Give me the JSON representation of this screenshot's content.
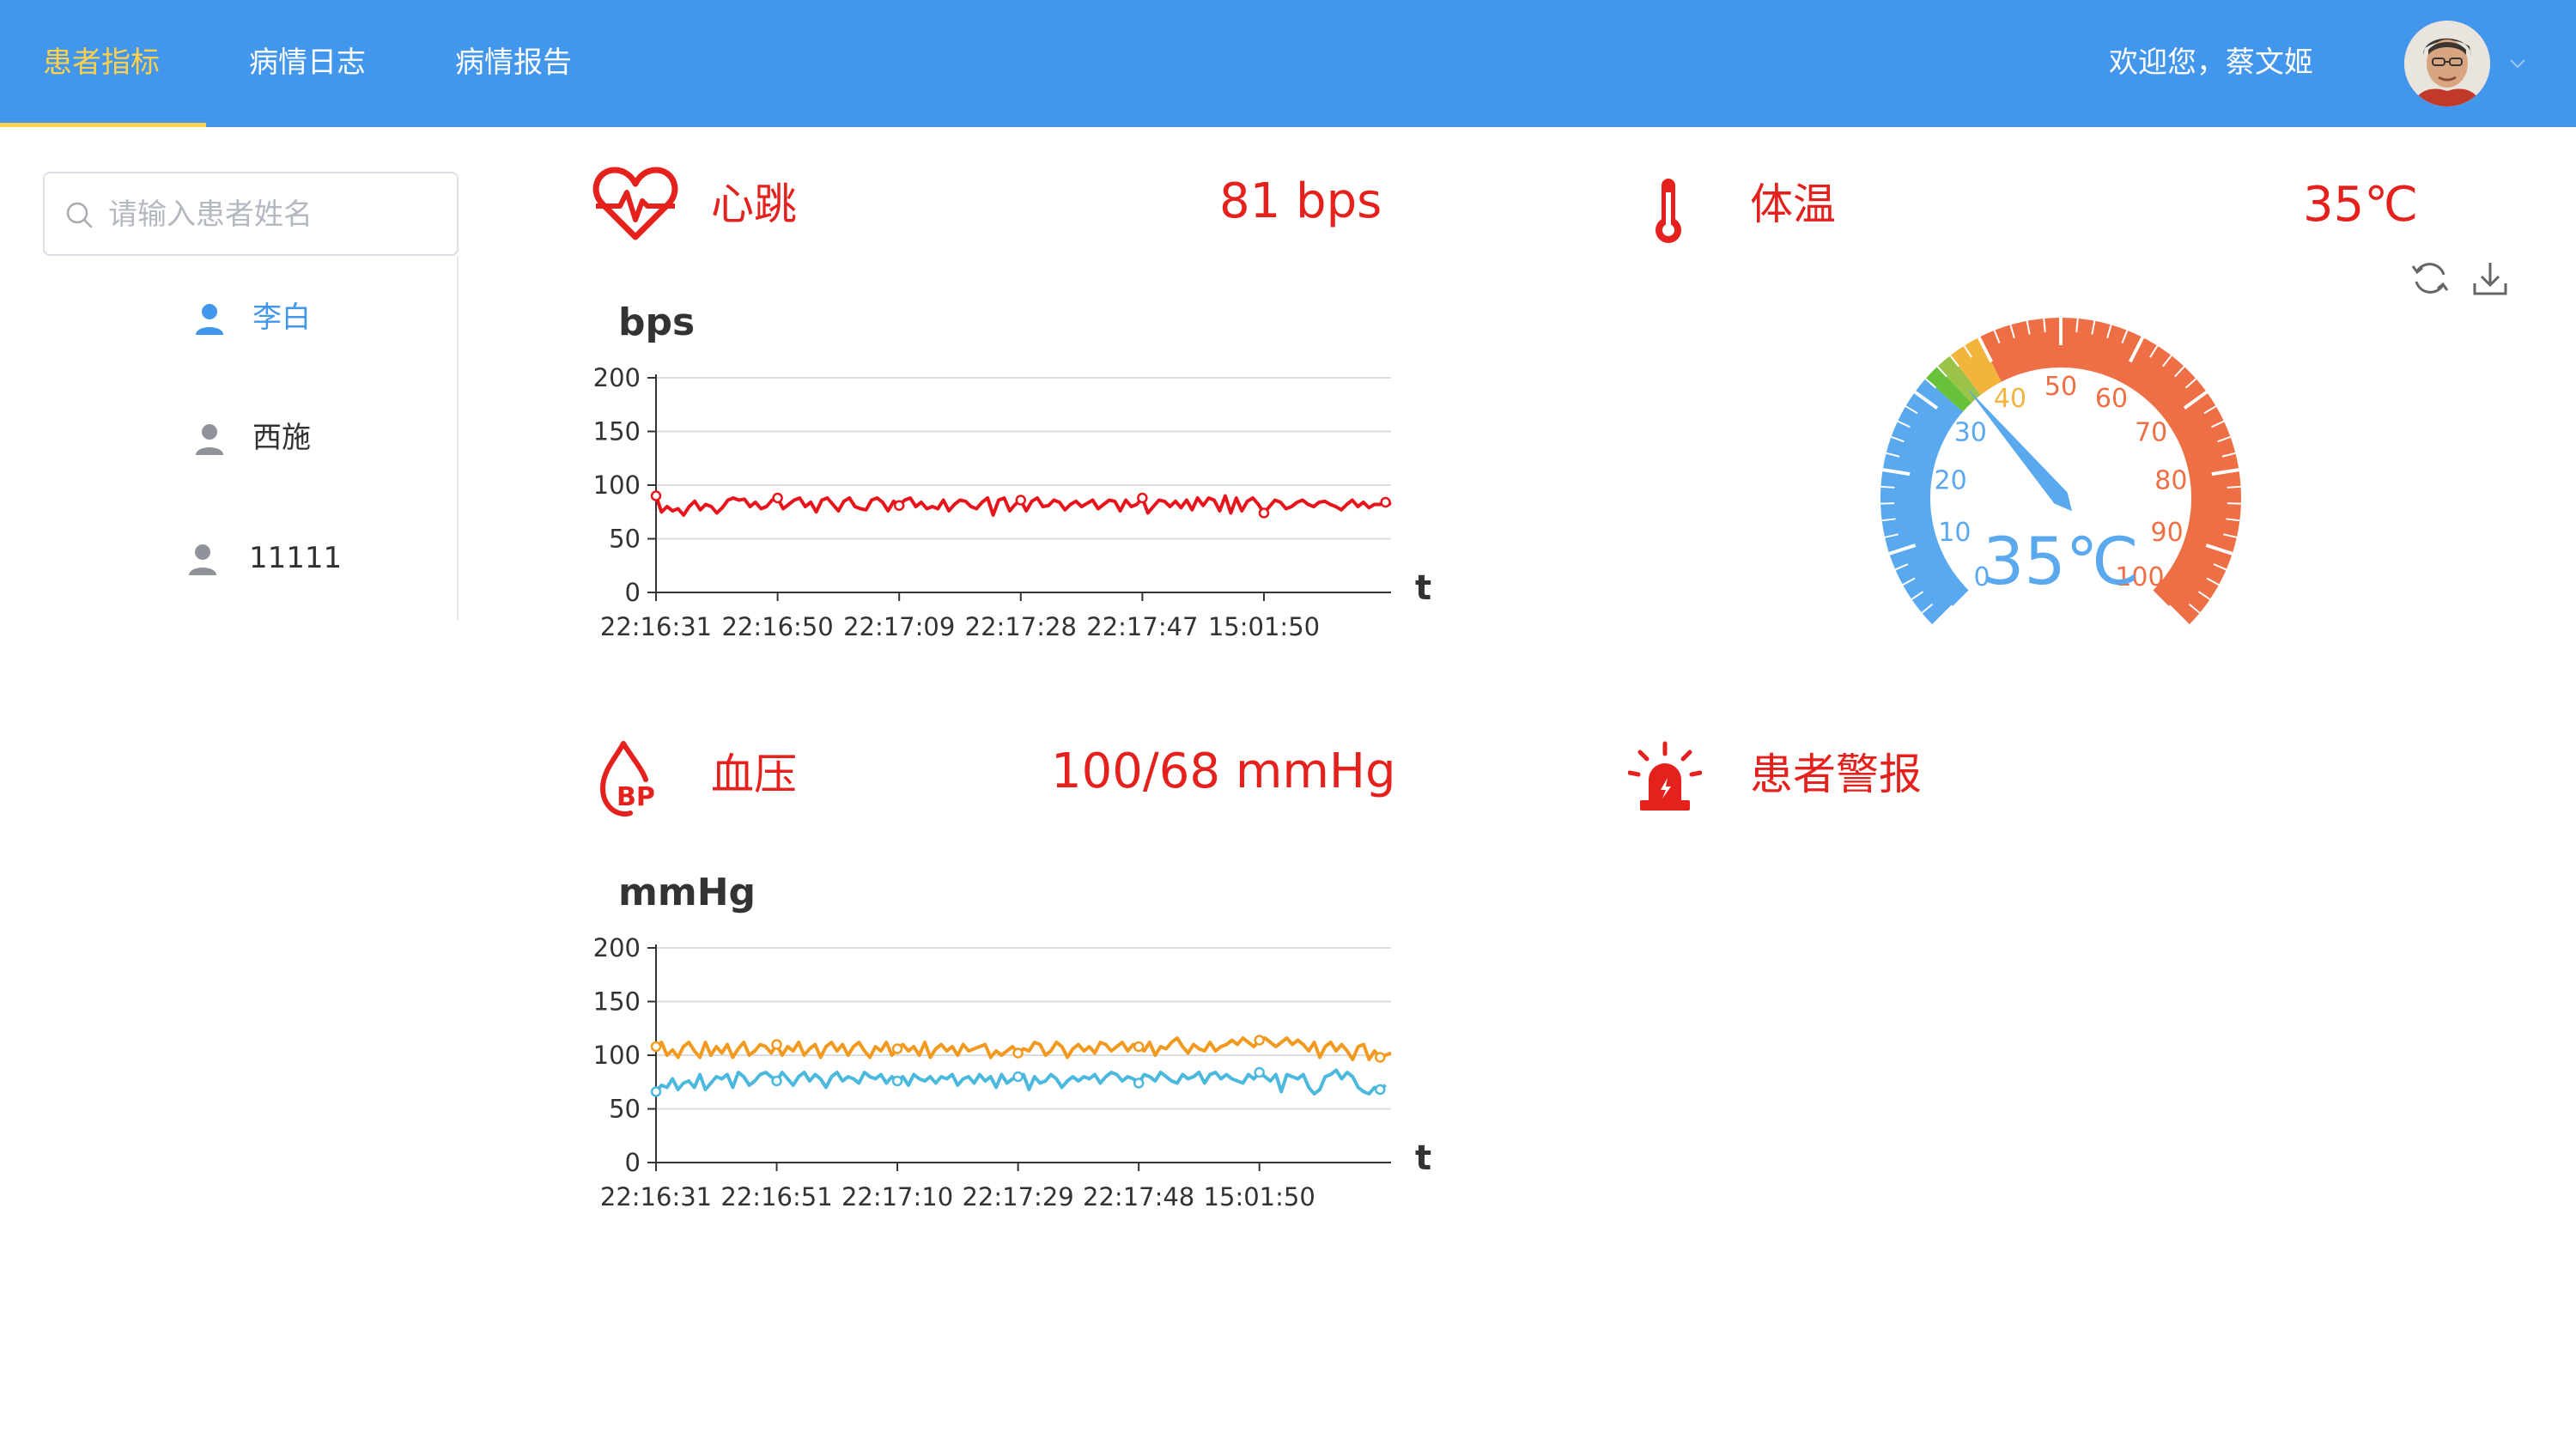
{
  "nav": {
    "tabs": [
      {
        "label": "患者指标",
        "active": true
      },
      {
        "label": "病情日志",
        "active": false
      },
      {
        "label": "病情报告",
        "active": false
      }
    ],
    "welcome": "欢迎您，蔡文姬"
  },
  "sidebar": {
    "search_placeholder": "请输入患者姓名",
    "patients": [
      {
        "name": "李白",
        "active": true
      },
      {
        "name": "西施",
        "active": false
      },
      {
        "name": "11111",
        "active": false
      }
    ]
  },
  "cards": {
    "heartbeat": {
      "title": "心跳",
      "value": "81 bps"
    },
    "temperature": {
      "title": "体温",
      "value": "35℃"
    },
    "blood_pressure": {
      "title": "血压",
      "value": "100/68 mmHg"
    },
    "alarm": {
      "title": "患者警报"
    }
  },
  "colors": {
    "topbar": "#4296eb",
    "active_tab": "#ffd04b",
    "alert_red": "#e5211d",
    "line_red": "#e8141c",
    "line_orange": "#f29a1f",
    "line_blue": "#4bb8de",
    "gauge_blue": "#5aa8ee",
    "gauge_orange": "#ee6f46"
  },
  "chart_data": [
    {
      "type": "line",
      "ylabel": "bps",
      "xlabel": "t",
      "ylim": [
        0,
        200
      ],
      "yticks": [
        0,
        50,
        100,
        150,
        200
      ],
      "xticks": [
        "22:16:31",
        "22:16:50",
        "22:17:09",
        "22:17:28",
        "22:17:47",
        "15:01:50"
      ],
      "grid": true,
      "series": [
        {
          "color": "#e8141c",
          "values": [
            90,
            75,
            80,
            76,
            78,
            72,
            80,
            85,
            77,
            82,
            80,
            74,
            79,
            86,
            88,
            86,
            87,
            80,
            84,
            78,
            80,
            86,
            88,
            78,
            82,
            86,
            88,
            80,
            84,
            75,
            86,
            88,
            82,
            76,
            85,
            88,
            80,
            78,
            77,
            86,
            88,
            84,
            76,
            85,
            81,
            86,
            88,
            80,
            84,
            78,
            80,
            78,
            86,
            76,
            82,
            86,
            85,
            80,
            78,
            84,
            88,
            72,
            86,
            88,
            76,
            82,
            86,
            76,
            85,
            88,
            80,
            81,
            86,
            84,
            77,
            82,
            85,
            80,
            83,
            86,
            78,
            82,
            86,
            85,
            76,
            86,
            80,
            82,
            88,
            74,
            80,
            86,
            85,
            80,
            85,
            79,
            86,
            77,
            88,
            81,
            88,
            86,
            76,
            90,
            74,
            88,
            76,
            85,
            88,
            82,
            74,
            80,
            86,
            84,
            78,
            80,
            84,
            86,
            82,
            80,
            84,
            85,
            82,
            80,
            77,
            82,
            86,
            80,
            84,
            79,
            82,
            82,
            84,
            82
          ]
        }
      ]
    },
    {
      "type": "line",
      "ylabel": "mmHg",
      "xlabel": "t",
      "ylim": [
        0,
        200
      ],
      "yticks": [
        0,
        50,
        100,
        150,
        200
      ],
      "xticks": [
        "22:16:31",
        "22:16:51",
        "22:17:10",
        "22:17:29",
        "22:17:48",
        "15:01:50"
      ],
      "grid": true,
      "series": [
        {
          "color": "#f29a1f",
          "values": [
            108,
            112,
            100,
            105,
            98,
            108,
            112,
            104,
            98,
            112,
            100,
            108,
            102,
            110,
            98,
            106,
            112,
            100,
            104,
            110,
            108,
            102,
            110,
            100,
            108,
            104,
            112,
            100,
            106,
            110,
            98,
            108,
            112,
            104,
            110,
            100,
            108,
            112,
            104,
            98,
            108,
            104,
            112,
            100,
            106,
            110,
            104,
            108,
            100,
            112,
            98,
            106,
            110,
            104,
            108,
            100,
            110,
            104,
            106,
            108,
            110,
            98,
            104,
            100,
            104,
            108,
            102,
            106,
            104,
            112,
            110,
            100,
            104,
            112,
            108,
            98,
            106,
            110,
            104,
            108,
            102,
            112,
            110,
            104,
            108,
            112,
            104,
            110,
            108,
            104,
            112,
            100,
            108,
            106,
            112,
            116,
            108,
            102,
            110,
            106,
            104,
            112,
            104,
            108,
            110,
            114,
            110,
            116,
            112,
            108,
            114,
            116,
            112,
            108,
            112,
            116,
            110,
            114,
            110,
            104,
            112,
            98,
            108,
            112,
            104,
            110,
            104,
            96,
            108,
            110,
            96,
            104,
            98,
            100,
            102
          ]
        },
        {
          "color": "#4bb8de",
          "values": [
            66,
            72,
            70,
            78,
            68,
            74,
            76,
            70,
            82,
            68,
            74,
            80,
            78,
            82,
            70,
            84,
            80,
            72,
            76,
            82,
            84,
            80,
            76,
            84,
            78,
            72,
            80,
            84,
            76,
            82,
            78,
            70,
            80,
            84,
            76,
            80,
            78,
            74,
            84,
            80,
            78,
            82,
            74,
            80,
            76,
            80,
            72,
            82,
            78,
            76,
            80,
            74,
            80,
            78,
            82,
            72,
            78,
            80,
            74,
            82,
            76,
            80,
            70,
            82,
            74,
            78,
            80,
            82,
            68,
            80,
            74,
            76,
            82,
            78,
            70,
            76,
            80,
            76,
            80,
            78,
            82,
            74,
            80,
            84,
            82,
            76,
            80,
            78,
            74,
            82,
            80,
            76,
            84,
            80,
            76,
            74,
            82,
            78,
            80,
            84,
            74,
            82,
            84,
            78,
            82,
            78,
            76,
            74,
            82,
            78,
            84,
            80,
            76,
            82,
            66,
            82,
            80,
            78,
            82,
            70,
            64,
            68,
            80,
            82,
            86,
            78,
            84,
            80,
            70,
            66,
            64,
            70,
            68,
            72
          ]
        }
      ]
    },
    {
      "type": "gauge",
      "min": 0,
      "max": 100,
      "value": 35,
      "detail": "35℃",
      "axis_labels": [
        "0",
        "10",
        "20",
        "30",
        "40",
        "50",
        "60",
        "70",
        "80",
        "90",
        "100"
      ],
      "color_bands": [
        {
          "to": 0.32,
          "color": "#5aa8ee"
        },
        {
          "to": 0.34,
          "color": "#67c23a"
        },
        {
          "to": 0.36,
          "color": "#9bc34a"
        },
        {
          "to": 0.4,
          "color": "#f3b43c"
        },
        {
          "to": 1.0,
          "color": "#ee6f46"
        }
      ]
    }
  ]
}
